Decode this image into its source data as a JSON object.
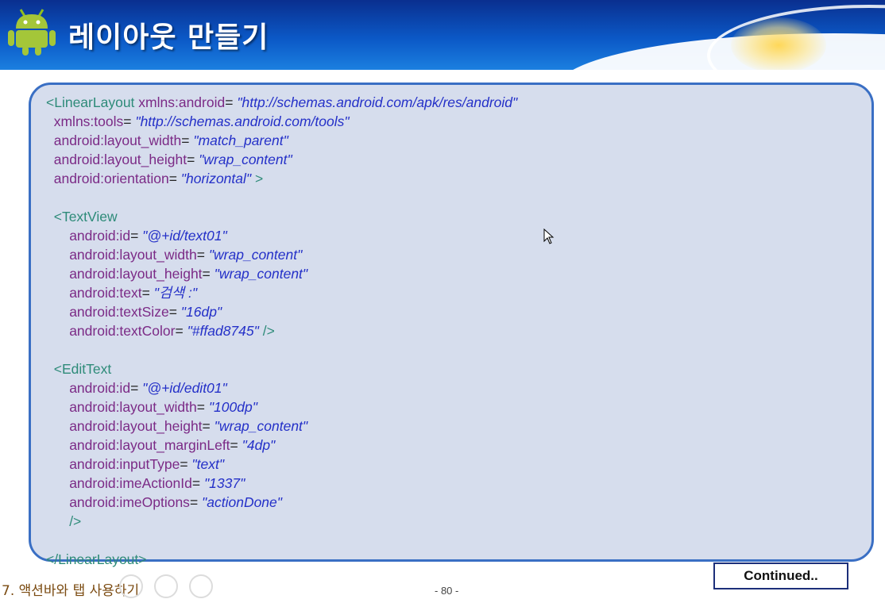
{
  "slide": {
    "title": "레이아웃 만들기",
    "continued_label": "Continued..",
    "footer_chapter": "7. 액션바와 탭 사용하기",
    "page_number": "- 80 -"
  },
  "colors": {
    "header": "#0b58c6",
    "panel_fill": "#d6dded",
    "panel_border": "#3a6fc4",
    "tag": "#2e8b79",
    "attribute": "#7b2a86",
    "value": "#2430c8"
  },
  "icons": {
    "logo": "android-robot-icon",
    "pointer": "mouse-cursor-icon"
  },
  "code": [
    {
      "indent": "",
      "segments": [
        {
          "t": "tag",
          "v": "<LinearLayout "
        },
        {
          "t": "attr",
          "v": "xmlns:android"
        },
        {
          "t": "eq",
          "v": "= "
        },
        {
          "t": "val",
          "v": "\"http://schemas.android.com/apk/res/android\""
        }
      ]
    },
    {
      "indent": "  ",
      "segments": [
        {
          "t": "attr",
          "v": "xmlns:tools"
        },
        {
          "t": "eq",
          "v": "= "
        },
        {
          "t": "val",
          "v": "\"http://schemas.android.com/tools\""
        }
      ]
    },
    {
      "indent": "  ",
      "segments": [
        {
          "t": "attr",
          "v": "android:layout_width"
        },
        {
          "t": "eq",
          "v": "= "
        },
        {
          "t": "val",
          "v": "\"match_parent\""
        }
      ]
    },
    {
      "indent": "  ",
      "segments": [
        {
          "t": "attr",
          "v": "android:layout_height"
        },
        {
          "t": "eq",
          "v": "= "
        },
        {
          "t": "val",
          "v": "\"wrap_content\""
        }
      ]
    },
    {
      "indent": "  ",
      "segments": [
        {
          "t": "attr",
          "v": "android:orientation"
        },
        {
          "t": "eq",
          "v": "= "
        },
        {
          "t": "val",
          "v": "\"horizontal\""
        },
        {
          "t": "tag",
          "v": " >"
        }
      ]
    },
    {
      "indent": "",
      "segments": []
    },
    {
      "indent": "  ",
      "segments": [
        {
          "t": "tag",
          "v": "<TextView"
        }
      ]
    },
    {
      "indent": "      ",
      "segments": [
        {
          "t": "attr",
          "v": "android:id"
        },
        {
          "t": "eq",
          "v": "= "
        },
        {
          "t": "val",
          "v": "\"@+id/text01\""
        }
      ]
    },
    {
      "indent": "      ",
      "segments": [
        {
          "t": "attr",
          "v": "android:layout_width"
        },
        {
          "t": "eq",
          "v": "= "
        },
        {
          "t": "val",
          "v": "\"wrap_content\""
        }
      ]
    },
    {
      "indent": "      ",
      "segments": [
        {
          "t": "attr",
          "v": "android:layout_height"
        },
        {
          "t": "eq",
          "v": "= "
        },
        {
          "t": "val",
          "v": "\"wrap_content\""
        }
      ]
    },
    {
      "indent": "      ",
      "segments": [
        {
          "t": "attr",
          "v": "android:text"
        },
        {
          "t": "eq",
          "v": "= "
        },
        {
          "t": "val",
          "v": "\"검색 :\""
        }
      ]
    },
    {
      "indent": "      ",
      "segments": [
        {
          "t": "attr",
          "v": "android:textSize"
        },
        {
          "t": "eq",
          "v": "= "
        },
        {
          "t": "val",
          "v": "\"16dp\""
        }
      ]
    },
    {
      "indent": "      ",
      "segments": [
        {
          "t": "attr",
          "v": "android:textColor"
        },
        {
          "t": "eq",
          "v": "= "
        },
        {
          "t": "val",
          "v": "\"#ffad8745\""
        },
        {
          "t": "tag",
          "v": " />"
        }
      ]
    },
    {
      "indent": "",
      "segments": []
    },
    {
      "indent": "  ",
      "segments": [
        {
          "t": "tag",
          "v": "<EditText"
        }
      ]
    },
    {
      "indent": "      ",
      "segments": [
        {
          "t": "attr",
          "v": "android:id"
        },
        {
          "t": "eq",
          "v": "= "
        },
        {
          "t": "val",
          "v": "\"@+id/edit01\""
        }
      ]
    },
    {
      "indent": "      ",
      "segments": [
        {
          "t": "attr",
          "v": "android:layout_width"
        },
        {
          "t": "eq",
          "v": "= "
        },
        {
          "t": "val",
          "v": "\"100dp\""
        }
      ]
    },
    {
      "indent": "      ",
      "segments": [
        {
          "t": "attr",
          "v": "android:layout_height"
        },
        {
          "t": "eq",
          "v": "= "
        },
        {
          "t": "val",
          "v": "\"wrap_content\""
        }
      ]
    },
    {
      "indent": "      ",
      "segments": [
        {
          "t": "attr",
          "v": "android:layout_marginLeft"
        },
        {
          "t": "eq",
          "v": "= "
        },
        {
          "t": "val",
          "v": "\"4dp\""
        }
      ]
    },
    {
      "indent": "      ",
      "segments": [
        {
          "t": "attr",
          "v": "android:inputType"
        },
        {
          "t": "eq",
          "v": "= "
        },
        {
          "t": "val",
          "v": "\"text\""
        }
      ]
    },
    {
      "indent": "      ",
      "segments": [
        {
          "t": "attr",
          "v": "android:imeActionId"
        },
        {
          "t": "eq",
          "v": "= "
        },
        {
          "t": "val",
          "v": "\"1337\""
        }
      ]
    },
    {
      "indent": "      ",
      "segments": [
        {
          "t": "attr",
          "v": "android:imeOptions"
        },
        {
          "t": "eq",
          "v": "= "
        },
        {
          "t": "val",
          "v": "\"actionDone\""
        }
      ]
    },
    {
      "indent": "      ",
      "segments": [
        {
          "t": "tag",
          "v": "/>"
        }
      ]
    },
    {
      "indent": "",
      "segments": []
    },
    {
      "indent": "",
      "segments": [
        {
          "t": "tag",
          "v": "</LinearLayout>"
        }
      ]
    }
  ]
}
